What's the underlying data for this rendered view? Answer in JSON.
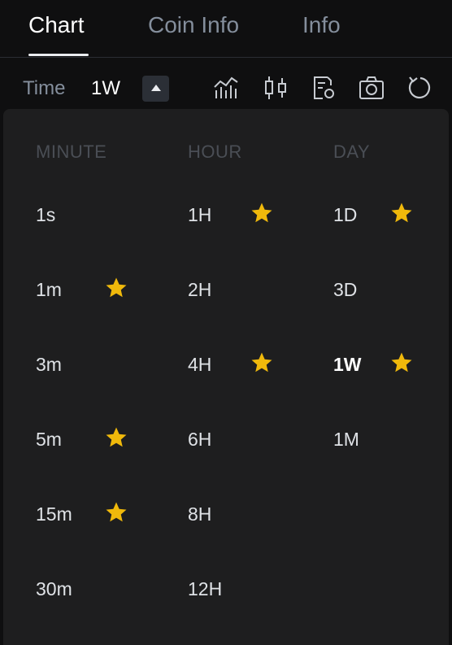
{
  "tabs": [
    {
      "label": "Chart",
      "active": true
    },
    {
      "label": "Coin Info",
      "active": false
    },
    {
      "label": "Info",
      "active": false
    }
  ],
  "toolbar": {
    "time_label": "Time",
    "interval_value": "1W",
    "icons": [
      "bar-chart-icon",
      "candlestick-icon",
      "chart-settings-icon",
      "camera-icon",
      "refresh-icon"
    ]
  },
  "interval_picker": {
    "columns": [
      {
        "header": "MINUTE",
        "items": [
          {
            "label": "1s",
            "favorite": false
          },
          {
            "label": "1m",
            "favorite": true
          },
          {
            "label": "3m",
            "favorite": false
          },
          {
            "label": "5m",
            "favorite": true
          },
          {
            "label": "15m",
            "favorite": true
          },
          {
            "label": "30m",
            "favorite": false
          }
        ]
      },
      {
        "header": "HOUR",
        "items": [
          {
            "label": "1H",
            "favorite": true
          },
          {
            "label": "2H",
            "favorite": false
          },
          {
            "label": "4H",
            "favorite": true
          },
          {
            "label": "6H",
            "favorite": false
          },
          {
            "label": "8H",
            "favorite": false
          },
          {
            "label": "12H",
            "favorite": false
          }
        ]
      },
      {
        "header": "DAY",
        "items": [
          {
            "label": "1D",
            "favorite": true
          },
          {
            "label": "3D",
            "favorite": false
          },
          {
            "label": "1W",
            "favorite": true,
            "selected": true
          },
          {
            "label": "1M",
            "favorite": false
          }
        ]
      }
    ],
    "star_color": "#f0b90b"
  }
}
